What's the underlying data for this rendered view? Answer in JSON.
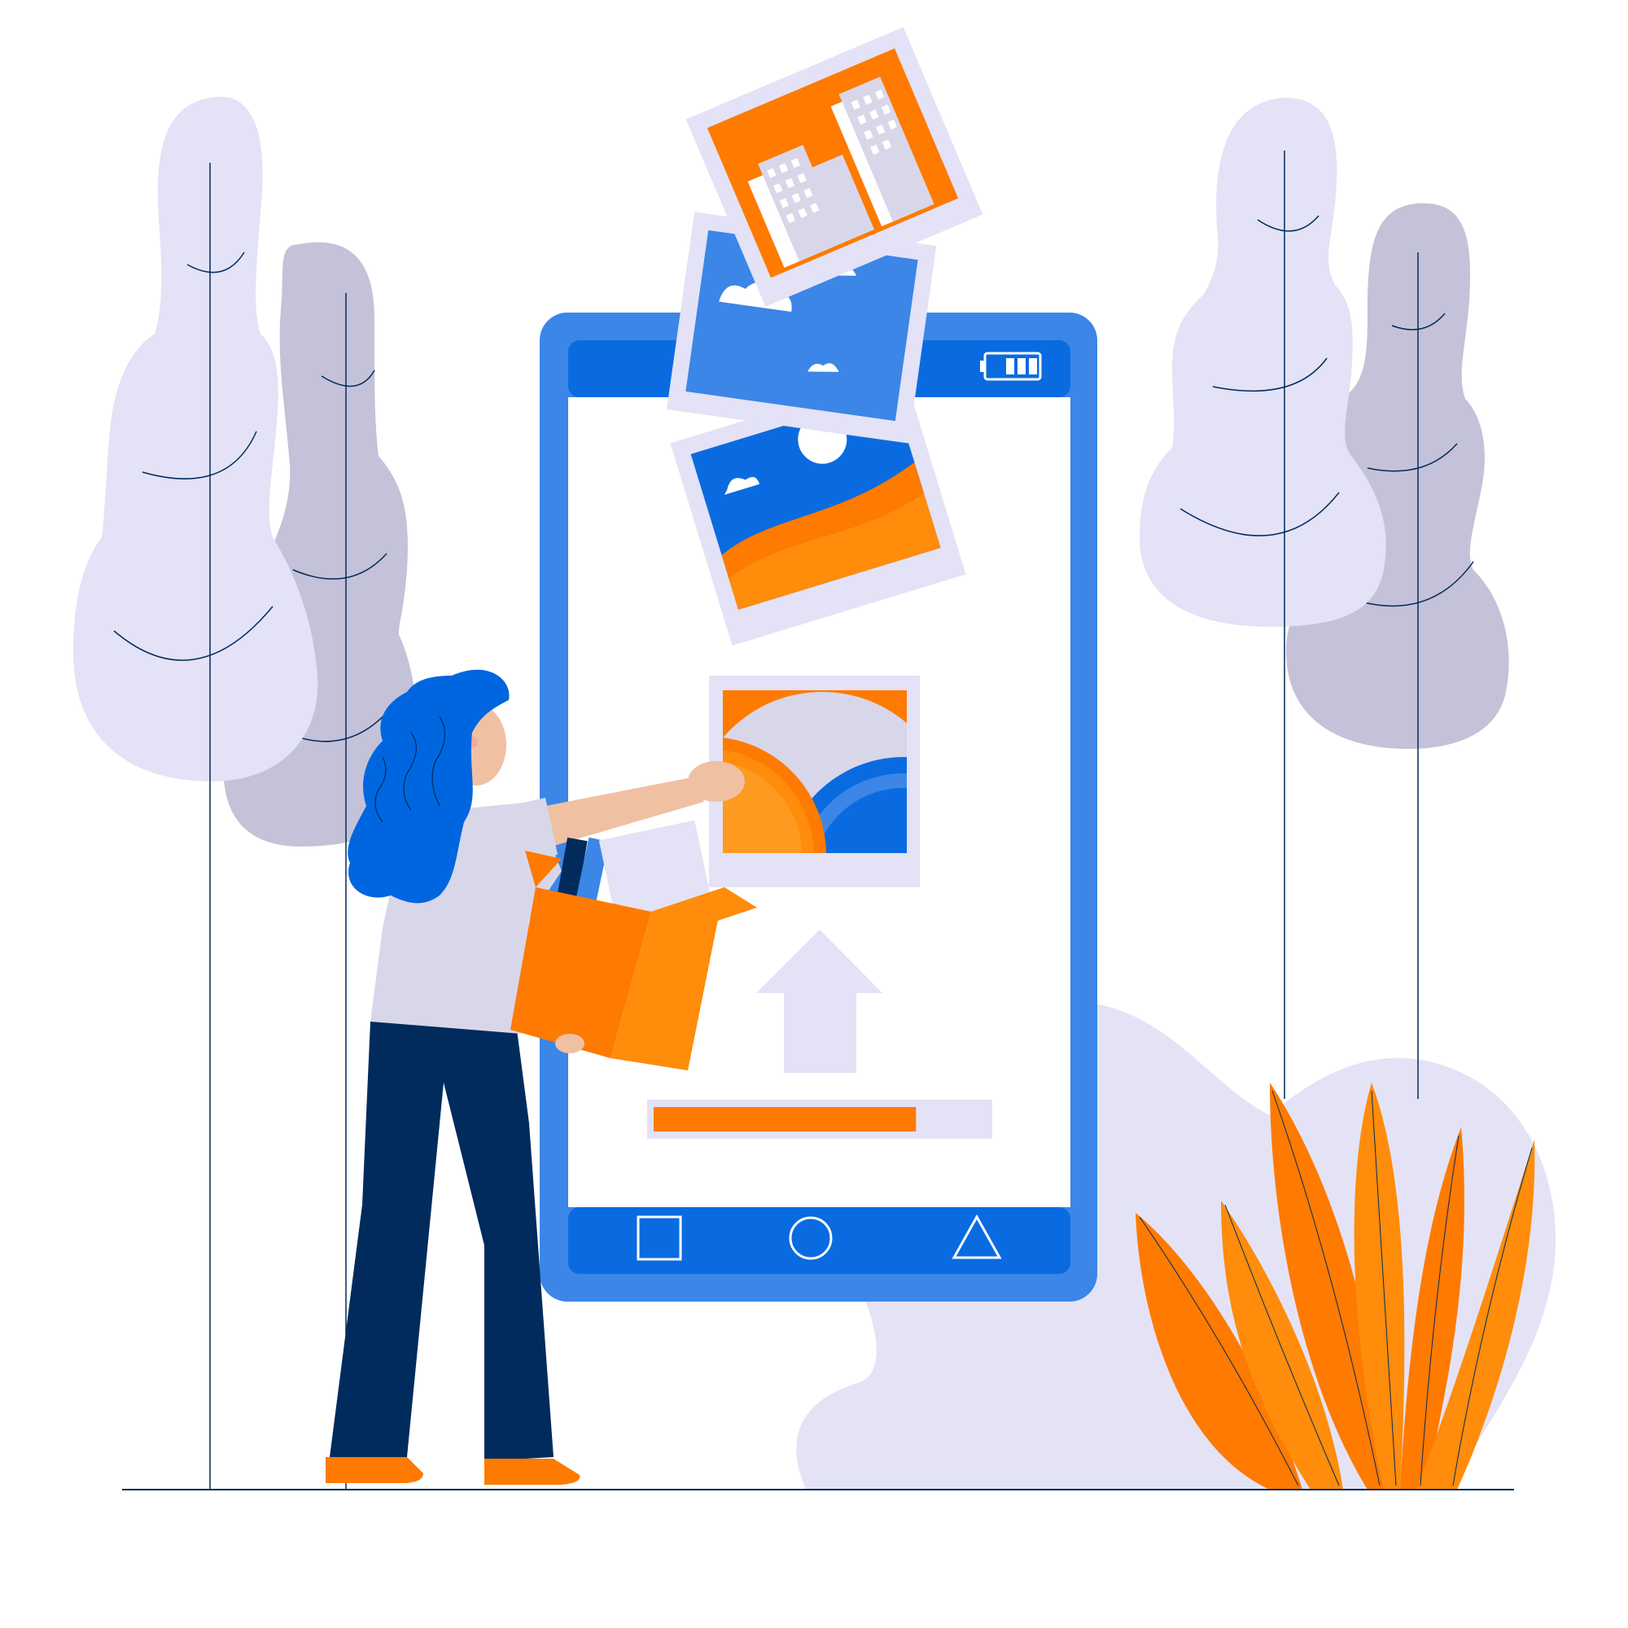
{
  "illustration": {
    "subject": "photo-upload",
    "upload_progress": 0.79,
    "status_bar": {
      "battery_level": 3,
      "battery_max": 3
    },
    "nav_buttons": [
      {
        "name": "square",
        "icon": "square-icon"
      },
      {
        "name": "circle",
        "icon": "circle-icon"
      },
      {
        "name": "triangle",
        "icon": "triangle-icon"
      }
    ],
    "colors": {
      "phone_blue": "#3b86e6",
      "phone_dark_blue": "#0a6be0",
      "orange": "#fe7a00",
      "light_orange": "#ff8c0a",
      "lavender": "#e3e2f6",
      "gray_lavender": "#c4c2d8",
      "navy": "#002b5c",
      "hair_blue": "#0066e0",
      "skin": "#f0c0a3"
    }
  }
}
